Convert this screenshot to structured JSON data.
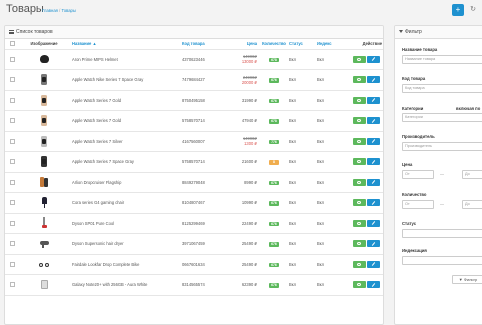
{
  "header": {
    "title": "Товары",
    "breadcrumb_home": "Главная",
    "breadcrumb_sep": "/",
    "breadcrumb_current": "Товары",
    "add_label": "+",
    "refresh_label": "↻"
  },
  "list_panel": {
    "title": "Список товаров",
    "columns": {
      "image": "Изображение",
      "name": "Название ▲",
      "model": "Код товара",
      "price": "Цена",
      "quantity": "Количество",
      "status": "Статус",
      "index": "Индекс",
      "action": "Действие"
    },
    "rows": [
      {
        "name": "Aron Prime MIPS Helmet",
        "model": "4370623446",
        "price": "",
        "old_price": "14990₽",
        "special": "13000 ₽",
        "qty": "678",
        "qty_color": "green",
        "status": "Вкл",
        "index": "Вкл",
        "icon": "helmet-icon"
      },
      {
        "name": "Apple Watch Nike Series 7 Space Gray",
        "model": "7479684427",
        "price": "",
        "old_price": "24990₽",
        "special": "20000 ₽",
        "qty": "676",
        "qty_color": "green",
        "status": "Вкл",
        "index": "Вкл",
        "icon": "watch-icon"
      },
      {
        "name": "Apple Watch Series 7 Gold",
        "model": "8750495158",
        "price": "31990 ₽",
        "old_price": "",
        "special": "",
        "qty": "676",
        "qty_color": "green",
        "status": "Вкл",
        "index": "Вкл",
        "icon": "watch-gold-icon"
      },
      {
        "name": "Apple Watch Series 7 Gold",
        "model": "5758570714",
        "price": "47940 ₽",
        "old_price": "",
        "special": "",
        "qty": "678",
        "qty_color": "green",
        "status": "Вкл",
        "index": "Вкл",
        "icon": "watch-gold-icon"
      },
      {
        "name": "Apple Watch Series 7 Silver",
        "model": "4167560007",
        "price": "",
        "old_price": "14990₽",
        "special": "1300 ₽",
        "qty": "776",
        "qty_color": "green",
        "status": "Вкл",
        "index": "Вкл",
        "icon": "watch-silver-icon"
      },
      {
        "name": "Apple Watch Series 7 Space Gray",
        "model": "5758570714",
        "price": "21600 ₽",
        "old_price": "",
        "special": "",
        "qty": "8",
        "qty_color": "orange",
        "status": "Вкл",
        "index": "Вкл",
        "icon": "watch-dark-icon"
      },
      {
        "name": "Arlion Dropcruiser Flagship",
        "model": "8849279048",
        "price": "8990 ₽",
        "old_price": "",
        "special": "",
        "qty": "676",
        "qty_color": "green",
        "status": "Вкл",
        "index": "Вкл",
        "icon": "phone-icon"
      },
      {
        "name": "Cora series G4 gaming chair",
        "model": "8104807467",
        "price": "10990 ₽",
        "old_price": "",
        "special": "",
        "qty": "676",
        "qty_color": "green",
        "status": "Вкл",
        "index": "Вкл",
        "icon": "chair-icon"
      },
      {
        "name": "Dyson SP01 Pure Cool",
        "model": "8125299469",
        "price": "22490 ₽",
        "old_price": "",
        "special": "",
        "qty": "676",
        "qty_color": "green",
        "status": "Вкл",
        "index": "Вкл",
        "icon": "vacuum-icon"
      },
      {
        "name": "Dyson Supersonic hair dryer",
        "model": "3971067459",
        "price": "25490 ₽",
        "old_price": "",
        "special": "",
        "qty": "676",
        "qty_color": "green",
        "status": "Вкл",
        "index": "Вкл",
        "icon": "dryer-icon"
      },
      {
        "name": "Fairdale Lookfar Drop Complete Bike",
        "model": "0667601634",
        "price": "25490 ₽",
        "old_price": "",
        "special": "",
        "qty": "676",
        "qty_color": "green",
        "status": "Вкл",
        "index": "Вкл",
        "icon": "bike-icon"
      },
      {
        "name": "Galaxy Note20+ with 256GB - Aura White",
        "model": "8314565574",
        "price": "62390 ₽",
        "old_price": "",
        "special": "",
        "qty": "676",
        "qty_color": "green",
        "status": "Вкл",
        "index": "Вкл",
        "icon": "tablet-icon"
      }
    ]
  },
  "filter_panel": {
    "title": "Фильтр",
    "name_label": "Название товара",
    "name_placeholder": "Название товара",
    "model_label": "Код товара",
    "model_placeholder": "Код товара",
    "category_label": "Категории",
    "category_extra": "включая по",
    "category_placeholder": "Категории",
    "manufacturer_label": "Производитель",
    "manufacturer_placeholder": "Производитель",
    "price_label": "Цена",
    "price_from": "От",
    "price_to": "До",
    "qty_label": "Количество",
    "qty_from": "От",
    "qty_to": "До",
    "status_label": "Статус",
    "index_label": "Индексация",
    "filter_button": "▼ Фильтр"
  },
  "colors": {
    "primary": "#1e91cf",
    "success": "#5cb85c",
    "warning": "#f0ad4e",
    "danger": "#d9534f"
  }
}
